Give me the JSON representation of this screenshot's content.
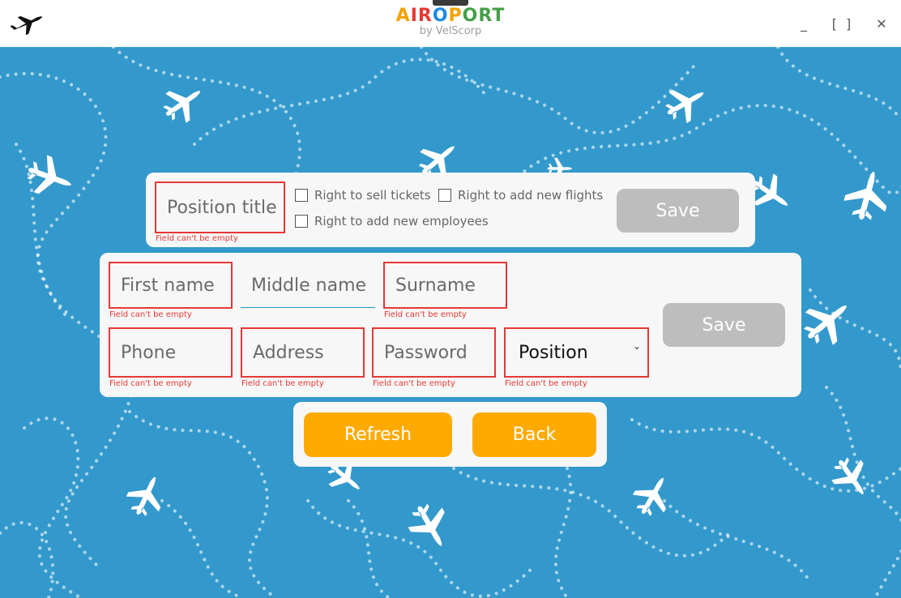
{
  "window": {
    "brand_letters": [
      {
        "ch": "A",
        "color": "#f4a100"
      },
      {
        "ch": "I",
        "color": "#e53935"
      },
      {
        "ch": "R",
        "color": "#e53935"
      },
      {
        "ch": "O",
        "color": "#1e88e5"
      },
      {
        "ch": "P",
        "color": "#f4a100"
      },
      {
        "ch": "O",
        "color": "#43a047"
      },
      {
        "ch": "R",
        "color": "#43a047"
      },
      {
        "ch": "T",
        "color": "#43a047"
      }
    ],
    "brand_subtitle": "by VelScorp",
    "minimize_label": "_",
    "maximize_label": "[ ]",
    "close_label": "✕",
    "app_icon": "airplane-icon"
  },
  "position_form": {
    "title_placeholder": "Position title",
    "title_error": "Field can't be empty",
    "checkboxes": [
      {
        "label": "Right to sell tickets",
        "checked": false
      },
      {
        "label": "Right to add new flights",
        "checked": false
      },
      {
        "label": "Right to add new employees",
        "checked": false
      }
    ],
    "save_label": "Save"
  },
  "employee_form": {
    "first_name": {
      "placeholder": "First name",
      "error": "Field can't be empty"
    },
    "middle_name": {
      "placeholder": "Middle name"
    },
    "surname": {
      "placeholder": "Surname",
      "error": "Field can't be empty"
    },
    "phone": {
      "placeholder": "Phone",
      "error": "Field can't be empty"
    },
    "address": {
      "placeholder": "Address",
      "error": "Field can't be empty"
    },
    "password": {
      "placeholder": "Password",
      "error": "Field can't be empty"
    },
    "position": {
      "placeholder": "Position",
      "error": "Field can't be empty"
    },
    "save_label": "Save"
  },
  "actions": {
    "refresh_label": "Refresh",
    "back_label": "Back"
  },
  "colors": {
    "background": "#3399cc",
    "panel": "#f7f7f7",
    "error": "#e53935",
    "accent_orange": "#ffaa00",
    "disabled_gray": "#bdbdbd"
  }
}
